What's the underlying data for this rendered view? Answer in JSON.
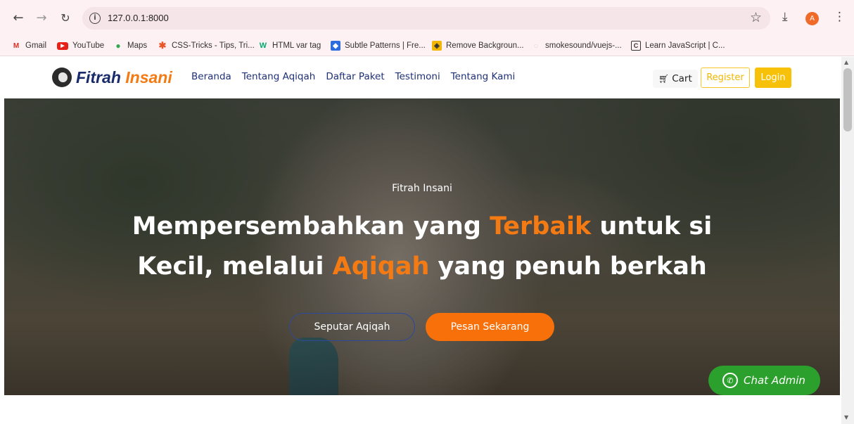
{
  "browser": {
    "url": "127.0.0.1:8000",
    "avatar_letter": "A",
    "bookmarks": [
      {
        "label": "Gmail",
        "icon": "gmail-icon"
      },
      {
        "label": "YouTube",
        "icon": "youtube-icon"
      },
      {
        "label": "Maps",
        "icon": "maps-icon"
      },
      {
        "label": "CSS-Tricks - Tips, Tri...",
        "icon": "css-tricks-icon"
      },
      {
        "label": "HTML var tag",
        "icon": "w3-icon"
      },
      {
        "label": "Subtle Patterns | Fre...",
        "icon": "subtle-patterns-icon"
      },
      {
        "label": "Remove Backgroun...",
        "icon": "remove-bg-icon"
      },
      {
        "label": "smokesound/vuejs-...",
        "icon": "github-icon"
      },
      {
        "label": "Learn JavaScript | C...",
        "icon": "codecademy-icon"
      }
    ]
  },
  "site": {
    "brand_part1": "Fitrah",
    "brand_part2": "Insani",
    "nav": [
      "Beranda",
      "Tentang Aqiqah",
      "Daftar Paket",
      "Testimoni",
      "Tentang Kami"
    ],
    "cart_label": "Cart",
    "register_label": "Register",
    "login_label": "Login"
  },
  "hero": {
    "kicker": "Fitrah Insani",
    "title_line1_a": "Mempersembahkan yang ",
    "title_line1_hl": "Terbaik",
    "title_line1_b": " untuk si",
    "title_line2_a": "Kecil, melalui ",
    "title_line2_hl": "Aqiqah",
    "title_line2_b": " yang penuh berkah",
    "secondary_button": "Seputar Aqiqah",
    "primary_button": "Pesan Sekarang",
    "chat_button": "Chat Admin"
  },
  "colors": {
    "accent_orange": "#f47a14",
    "brand_navy": "#1a2b6b",
    "login_yellow": "#f7c10a",
    "chat_green": "#2ca02c"
  }
}
